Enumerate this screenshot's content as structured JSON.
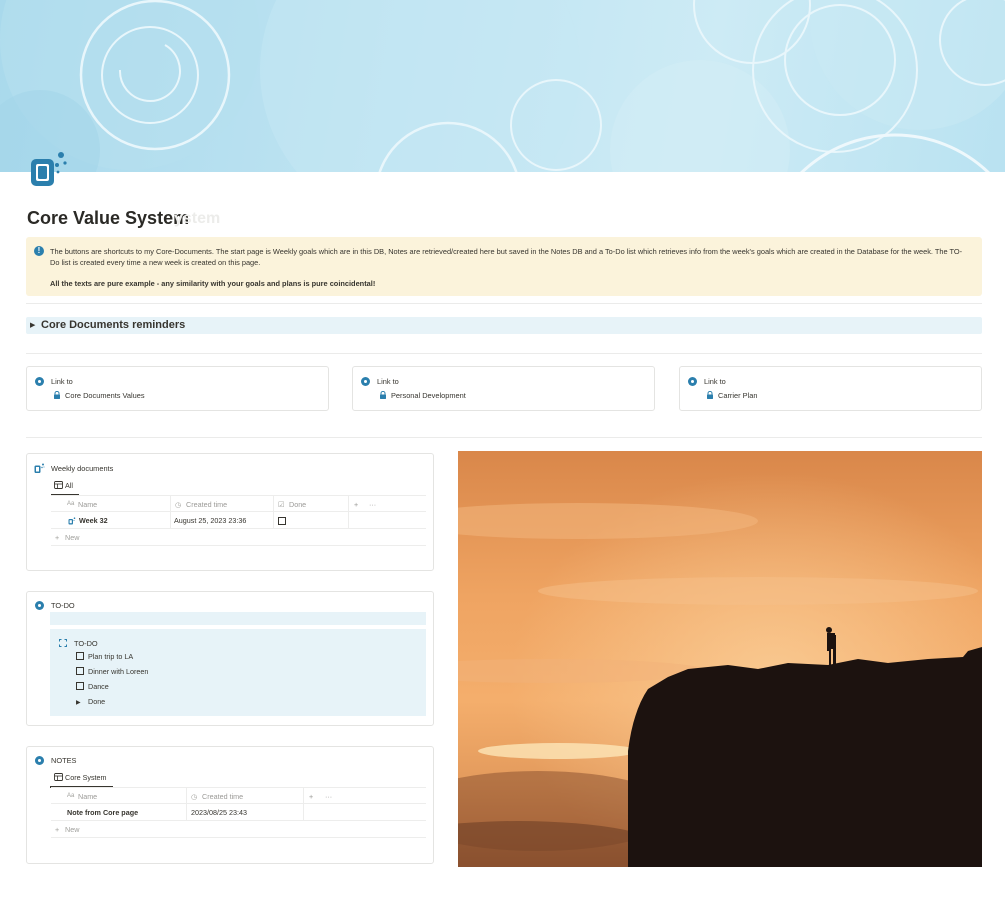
{
  "page": {
    "title": "Core Value System",
    "title_ghost": "ystem"
  },
  "callout": {
    "icon": "info-icon",
    "text": "The buttons are shortcuts to my Core-Documents. The start page is Weekly goals which are in this DB, Notes are retrieved/created here but saved in the Notes DB and a To-Do list which retrieves info from the week's goals which are created in the Database for the week. The TO-Do list is created every time a new week is created on this page.",
    "bold_text": "All the texts are pure example - any similarity with your goals and plans is pure coincidental!"
  },
  "toggle": {
    "label": "Core Documents reminders"
  },
  "links": [
    {
      "prefix": "Link to",
      "target": "Core Documents Values"
    },
    {
      "prefix": "Link to",
      "target": "Personal Development"
    },
    {
      "prefix": "Link to",
      "target": "Carrier Plan"
    }
  ],
  "weekly": {
    "title": "Weekly documents",
    "tab": "All",
    "columns": {
      "name": "Name",
      "created": "Created time",
      "done": "Done",
      "add": "+",
      "more": "···"
    },
    "rows": [
      {
        "name": "Week 32",
        "created": "August 25, 2023 23:36",
        "done": false
      }
    ],
    "new_label": "New"
  },
  "todo": {
    "title": "TO-DO",
    "inner_title": "TO-DO",
    "items": [
      {
        "label": "Plan trip to LA",
        "type": "checkbox"
      },
      {
        "label": "Dinner with Loreen",
        "type": "checkbox"
      },
      {
        "label": "Dance",
        "type": "checkbox"
      },
      {
        "label": "Done",
        "type": "toggle"
      }
    ]
  },
  "notes": {
    "title": "NOTES",
    "tab": "Core System",
    "columns": {
      "name": "Name",
      "created": "Created time",
      "add": "+",
      "more": "···"
    },
    "rows": [
      {
        "name": "Note from Core page",
        "created": "2023/08/25 23:43"
      }
    ],
    "new_label": "New"
  },
  "colors": {
    "accent": "#2b7fad",
    "callout_bg": "#fbf3db",
    "toggle_bg": "#e7f3f8"
  }
}
